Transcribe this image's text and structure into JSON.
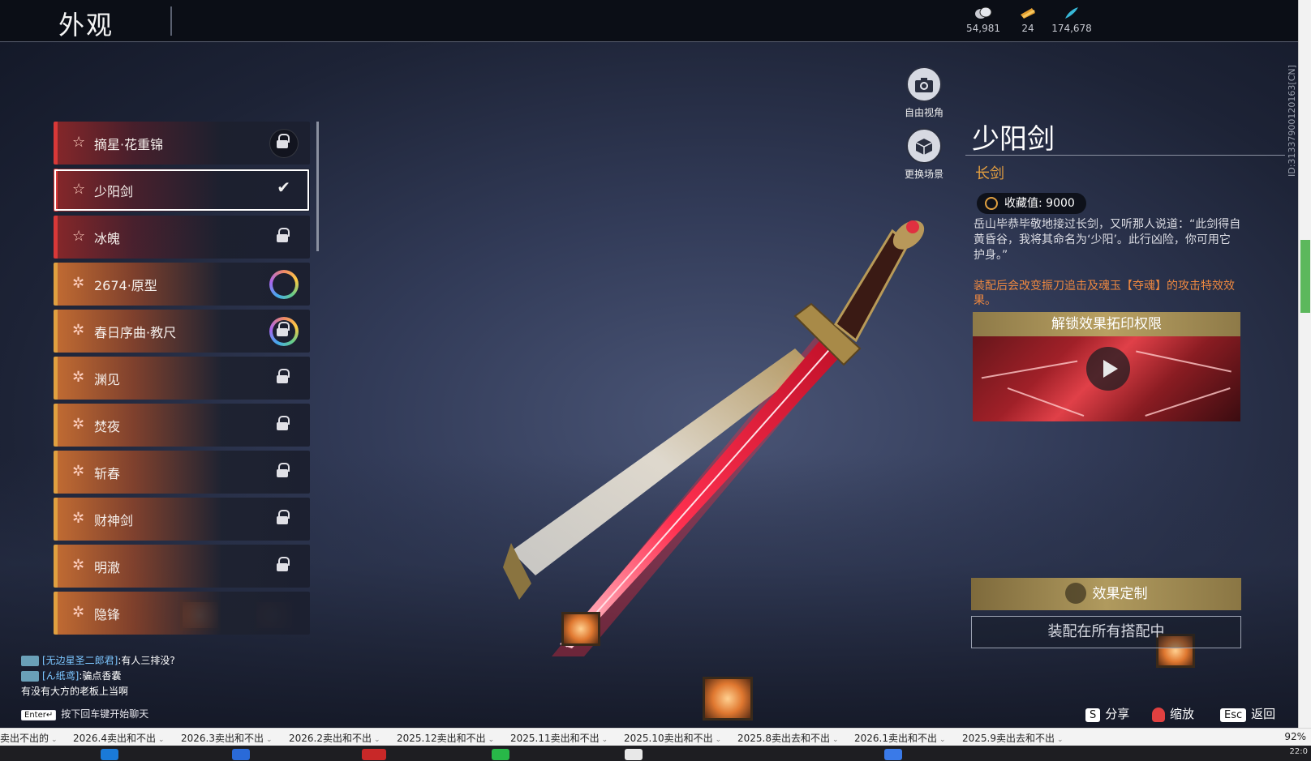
{
  "header": {
    "title": "外观",
    "currencies": [
      {
        "icon": "coin-icon",
        "value": "54,981"
      },
      {
        "icon": "ticket-icon",
        "value": "24"
      },
      {
        "icon": "feather-icon",
        "value": "174,678"
      }
    ]
  },
  "side_id": "ID:3133790012016​3[CN]",
  "list": {
    "items": [
      {
        "label": "摘星·花重锦",
        "rarity": "red",
        "state": "locked-circle"
      },
      {
        "label": "少阳剑",
        "rarity": "red",
        "state": "selected"
      },
      {
        "label": "冰魄",
        "rarity": "red",
        "state": "locked"
      },
      {
        "label": "2674·原型",
        "rarity": "orange",
        "state": "ring"
      },
      {
        "label": "春日序曲·教尺",
        "rarity": "orange",
        "state": "ring-locked"
      },
      {
        "label": "渊见",
        "rarity": "orange",
        "state": "locked"
      },
      {
        "label": "焚夜",
        "rarity": "orange",
        "state": "locked"
      },
      {
        "label": "斩春",
        "rarity": "orange",
        "state": "locked"
      },
      {
        "label": "财神剑",
        "rarity": "orange",
        "state": "locked"
      },
      {
        "label": "明澈",
        "rarity": "orange",
        "state": "locked"
      },
      {
        "label": "隐锋",
        "rarity": "orange",
        "state": "none"
      }
    ]
  },
  "view_buttons": {
    "free_view": "自由视角",
    "change_scene": "更换场景"
  },
  "detail": {
    "name": "少阳剑",
    "type": "长剑",
    "collection_label": "收藏值: 9000",
    "description": "岳山毕恭毕敬地接过长剑，又听那人说道：“此剑得自黄昏谷，我将其命名为‘少阳’。此行凶险，你可用它护身。”",
    "effect": "装配后会改变振刀追击及魂玉【夺魂】的攻击特效效果。",
    "unlock_title": "解锁效果拓印权限",
    "customize_button": "效果定制",
    "equipped_button": "装配在所有搭配中"
  },
  "chat": {
    "lines": [
      {
        "nick": "[无边星圣二郎君]",
        "text": ":有人三排没?"
      },
      {
        "nick": "[ん纸鸢]",
        "text": ":骗点香囊"
      },
      {
        "nick": "",
        "text": "有没有大方的老板上当啊"
      }
    ],
    "enter_key": "Enter↵",
    "enter_hint": "按下回车键开始聊天"
  },
  "hints": [
    {
      "key": "S",
      "label": "分享"
    },
    {
      "key": "",
      "label": "缩放"
    },
    {
      "key": "Esc",
      "label": "返回"
    }
  ],
  "browser_tabs": [
    "卖出不出的",
    "2026.4卖出和不出",
    "2026.3卖出和不出",
    "2026.2卖出和不出",
    "2025.12卖出和不出",
    "2025.11卖出和不出",
    "2025.10卖出和不出",
    "2025.8卖出去和不出",
    "2026.1卖出和不出",
    "2025.9卖出去和不出"
  ],
  "zoom": "92%",
  "clock": "22:0"
}
